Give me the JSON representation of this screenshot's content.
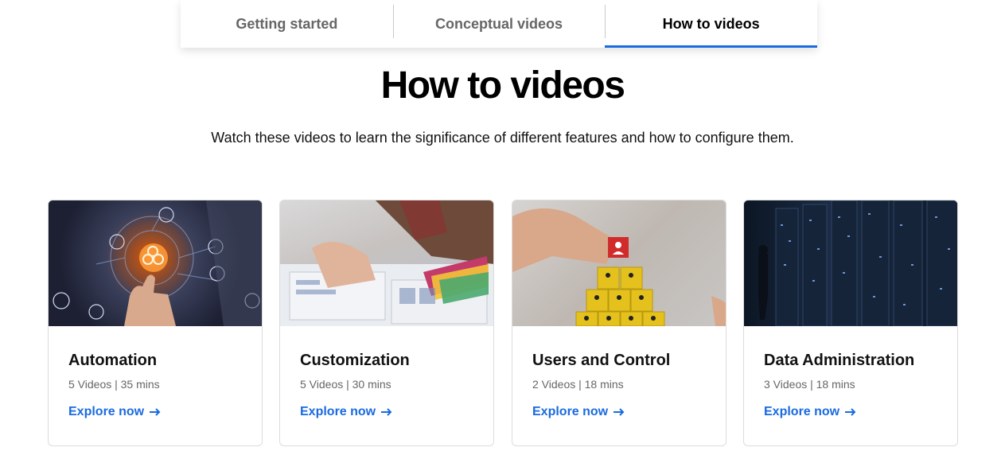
{
  "tabs": [
    {
      "label": "Getting started",
      "active": false
    },
    {
      "label": "Conceptual videos",
      "active": false
    },
    {
      "label": "How to videos",
      "active": true
    }
  ],
  "page": {
    "title": "How to videos",
    "subtitle": "Watch these videos to learn the significance of different features and how to configure them."
  },
  "cards": [
    {
      "title": "Automation",
      "meta": "5 Videos | 35 mins",
      "link": "Explore now"
    },
    {
      "title": "Customization",
      "meta": "5 Videos | 30 mins",
      "link": "Explore now"
    },
    {
      "title": "Users and Control",
      "meta": "2 Videos | 18 mins",
      "link": "Explore now"
    },
    {
      "title": "Data Administration",
      "meta": "3 Videos | 18 mins",
      "link": "Explore now"
    }
  ],
  "colors": {
    "accent": "#1a6be0"
  },
  "icons": {
    "link_arrow": "arrow-right-icon"
  }
}
